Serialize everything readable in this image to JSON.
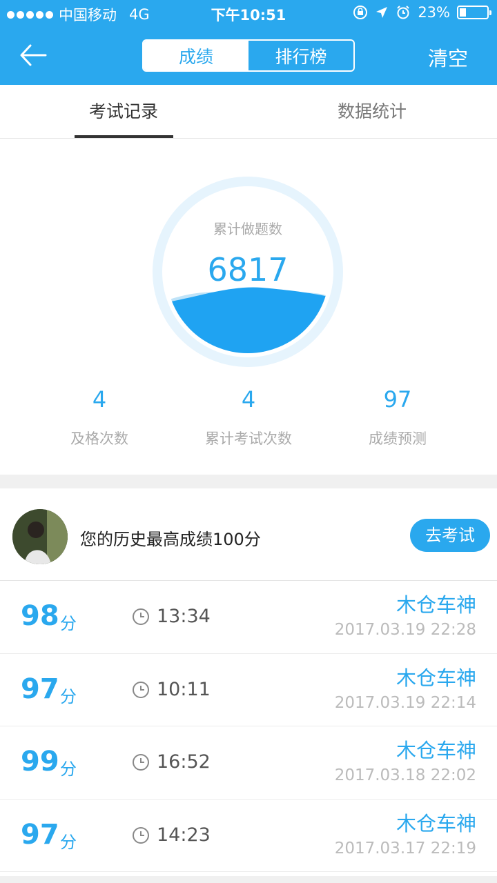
{
  "status_bar": {
    "carrier": "中国移动",
    "network": "4G",
    "time": "下午10:51",
    "battery": "23%"
  },
  "nav": {
    "segments": [
      "成绩",
      "排行榜"
    ],
    "active_segment": "成绩",
    "clear_label": "清空"
  },
  "tabs": [
    "考试记录",
    "数据统计"
  ],
  "summary": {
    "total_label": "累计做题数",
    "total_value": "6817",
    "stats": [
      {
        "value": "4",
        "label": "及格次数"
      },
      {
        "value": "4",
        "label": "累计考试次数"
      },
      {
        "value": "97",
        "label": "成绩预测"
      }
    ]
  },
  "best": {
    "text": "您的历史最高成绩100分",
    "button_label": "去考试"
  },
  "records": [
    {
      "score": "98",
      "unit": "分",
      "duration": "13:34",
      "user": "木仓车神",
      "date": "2017.03.19 22:28"
    },
    {
      "score": "97",
      "unit": "分",
      "duration": "10:11",
      "user": "木仓车神",
      "date": "2017.03.19 22:14"
    },
    {
      "score": "99",
      "unit": "分",
      "duration": "16:52",
      "user": "木仓车神",
      "date": "2017.03.18 22:02"
    },
    {
      "score": "97",
      "unit": "分",
      "duration": "14:23",
      "user": "木仓车神",
      "date": "2017.03.17 22:19"
    }
  ],
  "colors": {
    "accent": "#2aa8ee",
    "muted_text": "#aaaaaa",
    "band": "#f0f0f0"
  },
  "icons": [
    "back-arrow-icon",
    "clock-icon",
    "location-arrow-icon",
    "alarm-icon",
    "lock-rotation-icon",
    "battery-icon"
  ]
}
